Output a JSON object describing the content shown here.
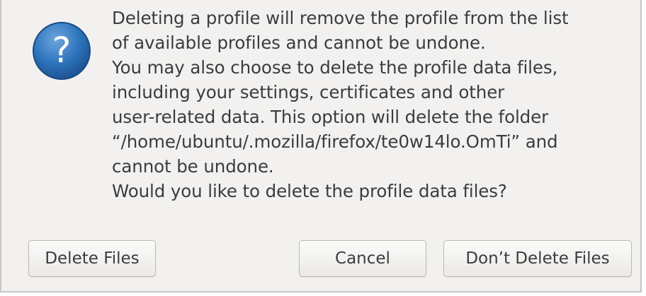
{
  "dialog": {
    "icon": "question-icon",
    "icon_glyph": "?",
    "message_lines": [
      "Deleting a profile will remove the profile from the list",
      "of available profiles and cannot be undone.",
      "You may also choose to delete the profile data files,",
      "including your settings, certificates and other",
      "user-related data. This option will delete the folder",
      "“/home/ubuntu/.mozilla/firefox/te0w14lo.OmTi” and",
      "cannot be undone.",
      "Would you like to delete the profile data files?"
    ],
    "buttons": {
      "delete_files": "Delete Files",
      "cancel": "Cancel",
      "dont_delete_files": "Don’t Delete Files"
    },
    "colors": {
      "icon_blue": "#2a6fb8",
      "background": "#f2f1f0",
      "text": "#3c3c3c"
    }
  }
}
